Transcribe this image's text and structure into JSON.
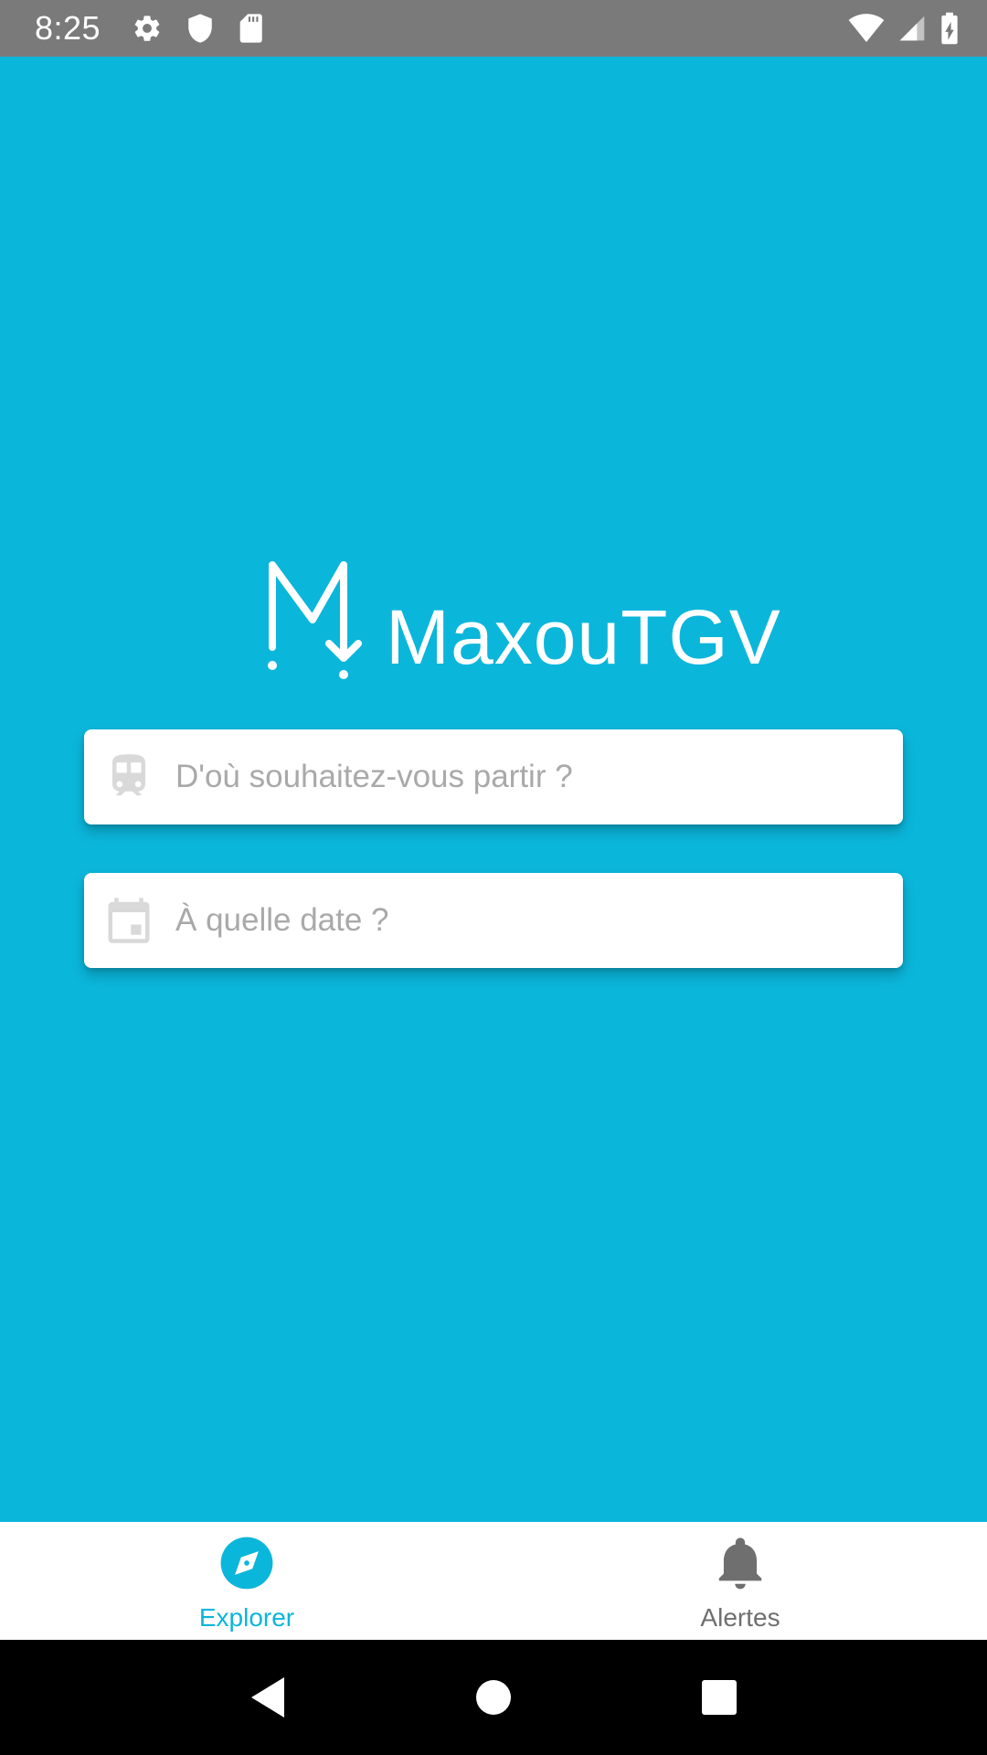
{
  "status_bar": {
    "time": "8:25",
    "icons": [
      "gear-icon",
      "shield-icon",
      "sd-card-icon",
      "wifi-icon",
      "cell-signal-icon",
      "battery-charging-icon"
    ]
  },
  "app": {
    "name": "MaxouTGV",
    "accent_color": "#0BB6DB"
  },
  "search": {
    "from_placeholder": "D'où souhaitez-vous partir ?",
    "from_icon": "train-icon",
    "date_placeholder": "À quelle date ?",
    "date_icon": "calendar-icon"
  },
  "bottom_nav": {
    "items": [
      {
        "label": "Explorer",
        "icon": "compass-icon",
        "active": true
      },
      {
        "label": "Alertes",
        "icon": "bell-icon",
        "active": false
      }
    ]
  },
  "system_nav": {
    "buttons": [
      "back-icon",
      "home-icon",
      "recents-icon"
    ]
  }
}
